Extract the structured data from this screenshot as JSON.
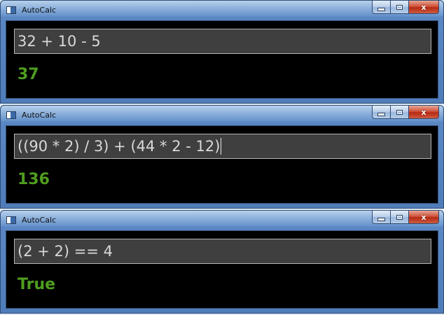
{
  "windows": [
    {
      "title": "AutoCalc",
      "expression": "32 + 10 - 5",
      "result": "37",
      "has_caret": false
    },
    {
      "title": "AutoCalc",
      "expression": "((90 * 2) / 3) + (44 * 2 - 12)",
      "result": "136",
      "has_caret": true
    },
    {
      "title": "AutoCalc",
      "expression": "(2 + 2) == 4",
      "result": "True",
      "has_caret": false
    }
  ],
  "caption_buttons": {
    "minimize_icon": "minimize-icon",
    "maximize_icon": "maximize-icon",
    "close_icon": "close-icon",
    "close_glyph": "x"
  },
  "colors": {
    "result_text": "#4f9e1f",
    "input_background": "#3f3f3f",
    "client_background": "#000000",
    "close_button": "#c7432b"
  }
}
